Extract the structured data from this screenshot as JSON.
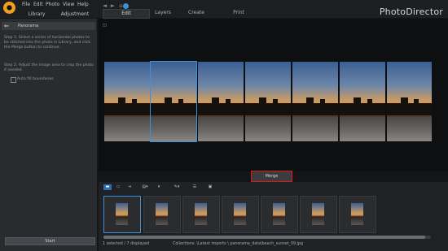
{
  "app": {
    "name": "PhotoDirector"
  },
  "menu": [
    "File",
    "Edit",
    "Photo",
    "View",
    "Help"
  ],
  "left_tabs": [
    "Library",
    "Adjustment"
  ],
  "main_tabs": [
    "Edit",
    "Layers",
    "Create",
    "Print"
  ],
  "left_panel": {
    "title": "Panorama",
    "step1": "Step 1: Select a series of horizontal photos to be stitched into the photo in Library, and click the Merge button to continue.",
    "step2": "Step 2: Adjust the image area to crop the photo if needed.",
    "checkbox_label": "Auto fill boundaries",
    "start_button": "Start"
  },
  "merge_button": "Merge",
  "status": {
    "selected": "1 selected / 7 displayed",
    "path": "Collections: \\Latest imports \\ panorama_data\\beach_sunset_09.jpg"
  },
  "thumbnails": [
    {
      "name": "thumb1"
    },
    {
      "name": "thumb2"
    },
    {
      "name": "thumb3"
    },
    {
      "name": "thumb4"
    },
    {
      "name": "thumb5"
    },
    {
      "name": "thumb6"
    },
    {
      "name": "thumb7"
    }
  ]
}
